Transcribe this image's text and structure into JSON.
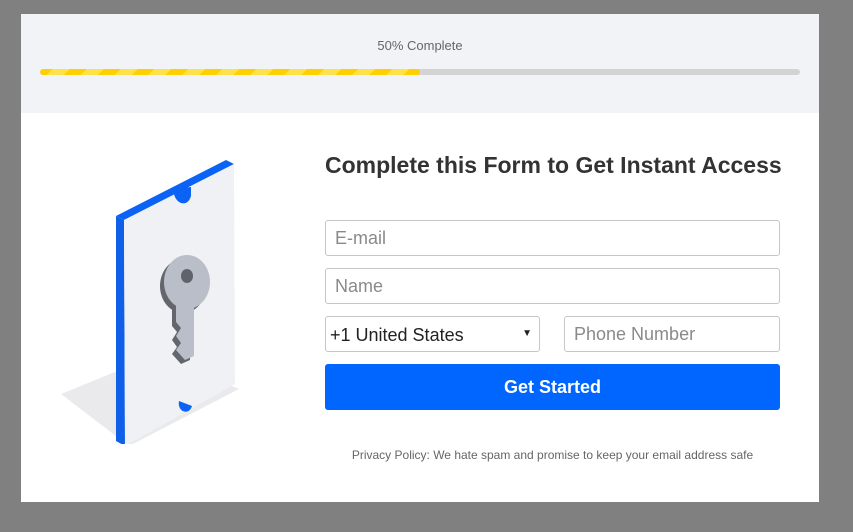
{
  "progress": {
    "label": "50% Complete",
    "percent": 50,
    "colors": {
      "fill": "#ffd000",
      "track": "#d3d3d3"
    }
  },
  "illustration": {
    "icon": "key-icon",
    "accent": "#0066ff"
  },
  "form": {
    "title": "Complete this Form to Get Instant Access",
    "email": {
      "placeholder": "E-mail",
      "value": ""
    },
    "name": {
      "placeholder": "Name",
      "value": ""
    },
    "country": {
      "selected": "+1 United States",
      "caret": "▼"
    },
    "phone": {
      "placeholder": "Phone Number",
      "value": ""
    },
    "submit_label": "Get Started",
    "privacy": "Privacy Policy: We hate spam and promise to keep your email address safe"
  },
  "colors": {
    "overlay": "#808080",
    "header_bg": "#f2f3f7",
    "button": "#0066ff",
    "title": "#333333"
  }
}
